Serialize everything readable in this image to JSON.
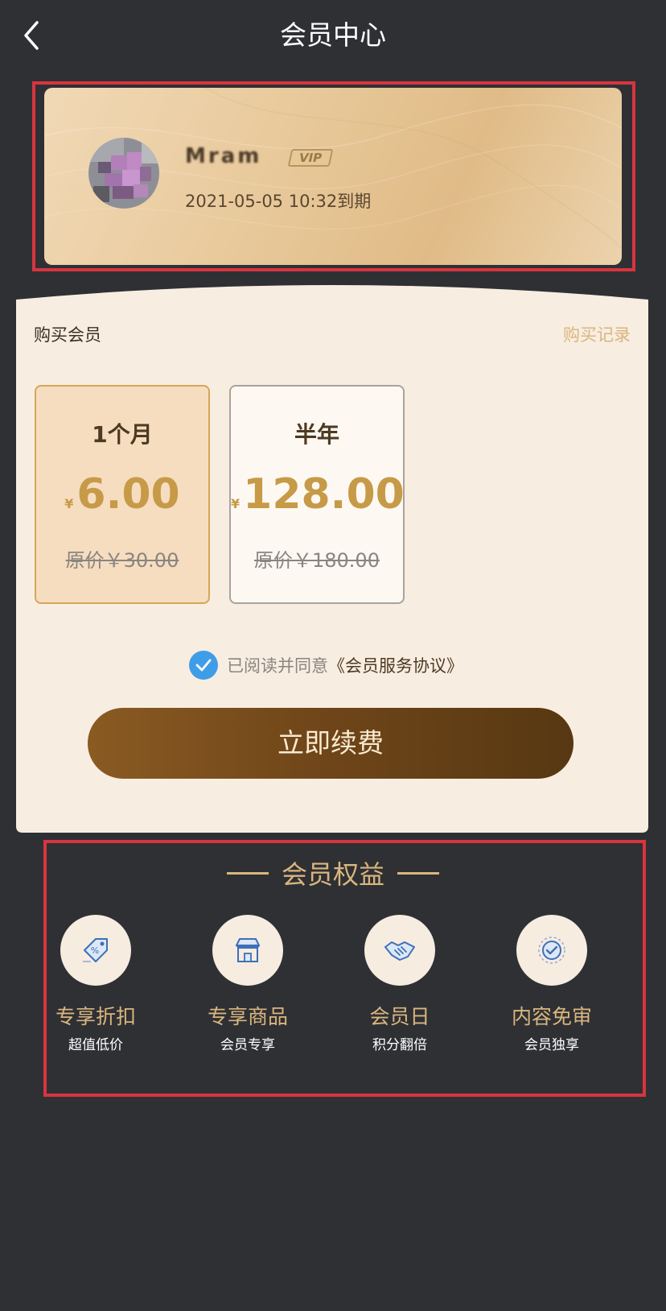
{
  "nav": {
    "title": "会员中心"
  },
  "vip_card": {
    "username": "Mram",
    "badge": "VIP",
    "expiry": "2021-05-05 10:32到期"
  },
  "purchase": {
    "title": "购买会员",
    "history_link": "购买记录",
    "plans": [
      {
        "name": "1个月",
        "currency": "¥",
        "price": "6.00",
        "original": "原价￥30.00",
        "selected": true
      },
      {
        "name": "半年",
        "currency": "¥",
        "price": "128.00",
        "original": "原价￥180.00",
        "selected": false
      }
    ],
    "agree_text": "已阅读并同意",
    "agree_link": "《会员服务协议》",
    "agree_checked": true,
    "button": "立即续费"
  },
  "benefits": {
    "title": "会员权益",
    "items": [
      {
        "icon": "discount-tag-icon",
        "title": "专享折扣",
        "sub": "超值低价"
      },
      {
        "icon": "store-icon",
        "title": "专享商品",
        "sub": "会员专享"
      },
      {
        "icon": "handshake-icon",
        "title": "会员日",
        "sub": "积分翻倍"
      },
      {
        "icon": "verified-check-icon",
        "title": "内容免审",
        "sub": "会员独享"
      }
    ]
  },
  "colors": {
    "accent": "#d9b67e",
    "price": "#c79a48",
    "button": "#6e4519",
    "check": "#3f9de8",
    "background": "#2f3034",
    "annotation": "#d8353f"
  }
}
